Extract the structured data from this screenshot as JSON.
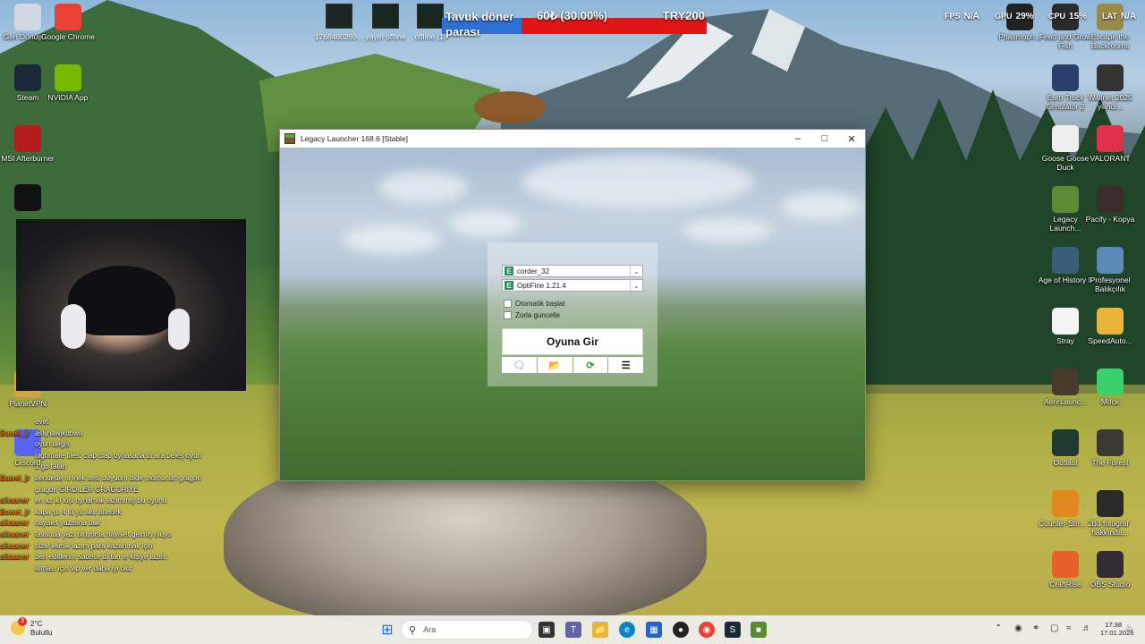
{
  "desktop_left": [
    {
      "id": "recycle",
      "label": "Geri Dönüşü...",
      "icon": "recycle-bin-icon",
      "color": "#cfd8e3"
    },
    {
      "id": "chrome",
      "label": "Google Chrome",
      "icon": "chrome-icon",
      "color": "#e94235"
    },
    {
      "id": "steam",
      "label": "Steam",
      "icon": "steam-icon",
      "color": "#1b2838"
    },
    {
      "id": "nvidia",
      "label": "NVIDIA App",
      "icon": "nvidia-icon",
      "color": "#76b900"
    },
    {
      "id": "afterburner",
      "label": "MSI Afterburner",
      "icon": "afterburner-icon",
      "color": "#b51c1c"
    },
    {
      "id": "rave",
      "label": "",
      "icon": "rave-icon",
      "color": "#111111"
    },
    {
      "id": "planetvpn",
      "label": "PlanetVPN",
      "icon": "vpn-icon",
      "color": "#d8a33b"
    },
    {
      "id": "discord",
      "label": "Discord",
      "icon": "discord-icon",
      "color": "#5865f2"
    }
  ],
  "desktop_right": [
    {
      "id": "phasmo",
      "label": "Phasmoph...",
      "icon": "phasmophobia-icon",
      "color": "#222222"
    },
    {
      "id": "feedgrow",
      "label": "Feed and Grow Fish",
      "icon": "feed-grow-icon",
      "color": "#2a2a2a"
    },
    {
      "id": "backrooms",
      "label": "Escape the Backrooms",
      "icon": "backrooms-icon",
      "color": "#9a8a4a"
    },
    {
      "id": "ets2",
      "label": "Euro Truck Simulator 2",
      "icon": "truck-icon",
      "color": "#2b3f6b"
    },
    {
      "id": "wallnet",
      "label": "Wallnet 2025 yilindi...",
      "icon": "wallnet-icon",
      "color": "#333333"
    },
    {
      "id": "goose",
      "label": "Goose Goose Duck",
      "icon": "goose-icon",
      "color": "#eeeeee"
    },
    {
      "id": "valorant",
      "label": "VALORANT",
      "icon": "valorant-icon",
      "color": "#e0304a"
    },
    {
      "id": "legacy",
      "label": "Legacy Launch...",
      "icon": "minecraft-icon",
      "color": "#5b8a35"
    },
    {
      "id": "pacify",
      "label": "Pacify - Kopya",
      "icon": "pacify-icon",
      "color": "#3a2c2a"
    },
    {
      "id": "aoe2",
      "label": "Age of History II",
      "icon": "aoh-icon",
      "color": "#3a5d7a"
    },
    {
      "id": "fishing",
      "label": "Profesyonel Balıkçılık",
      "icon": "fishing-icon",
      "color": "#5a8ab5"
    },
    {
      "id": "stray",
      "label": "Stray",
      "icon": "stray-icon",
      "color": "#f4f4f4"
    },
    {
      "id": "speedauto",
      "label": "SpeedAuto...",
      "icon": "folder-icon",
      "color": "#e8b43a"
    },
    {
      "id": "aerlaunch",
      "label": "AerirLaunc...",
      "icon": "aerir-icon",
      "color": "#4a3a2a"
    },
    {
      "id": "mock",
      "label": "Mock",
      "icon": "mock-icon",
      "color": "#3ad16a"
    },
    {
      "id": "outlast",
      "label": "Outlast",
      "icon": "outlast-icon",
      "color": "#1e3a30"
    },
    {
      "id": "forest",
      "label": "The Forest",
      "icon": "forest-icon",
      "color": "#3a3a33"
    },
    {
      "id": "cs2",
      "label": "Counter-Stri... 2",
      "icon": "cs2-icon",
      "color": "#e0871e"
    },
    {
      "id": "foto",
      "label": "Bu fotoğraf hakkında...",
      "icon": "camera-icon",
      "color": "#2a2a2a"
    },
    {
      "id": "craftrise",
      "label": "CraftRise",
      "icon": "craftrise-icon",
      "color": "#e8602a"
    },
    {
      "id": "obs",
      "label": "OBS Studio",
      "icon": "obs-icon",
      "color": "#302e31"
    }
  ],
  "top_tiles": [
    {
      "label": "1768480269...",
      "icon": "video-thumb-icon"
    },
    {
      "label": "yayın offline",
      "icon": "offline-thumb-icon"
    },
    {
      "label": "offline (1)",
      "icon": "offline-thumb-icon"
    }
  ],
  "goal": {
    "title": "Tavuk döner parası",
    "amount": "60₺ (30.00%)",
    "progress_percent": 30,
    "target": "TRY200",
    "fill_color": "#2f6fd6",
    "bar_color": "#e01515"
  },
  "perf": [
    {
      "label": "FPS",
      "value": "N/A"
    },
    {
      "label": "GPU",
      "value": "29%"
    },
    {
      "label": "CPU",
      "value": "15%"
    },
    {
      "label": "LAT",
      "value": "N/A"
    }
  ],
  "chat": [
    {
      "user": "",
      "text": "evet"
    },
    {
      "user": "Buwei_jr",
      "text": "aslijnawjkdbwa"
    },
    {
      "user": "",
      "text": "oyun değiş"
    },
    {
      "user": "",
      "text": "nighmare files: clap clap oynasana bi ara beleş oyun 1 gb falan"
    },
    {
      "user": "Buwei_jr",
      "text": "bendede ni inek sesi duyuom bide momunun gragori gragori GİRDİLER GRAGORİYE"
    },
    {
      "user": "alkaaner",
      "text": "en az iki kişi oynamak lazımmış bu oyunu"
    },
    {
      "user": "Buwei_jr",
      "text": "kapa şu 4 lü yü aku bitecek"
    },
    {
      "user": "alkaaner",
      "text": "hayalet yazısına bak"
    },
    {
      "user": "alkaaner",
      "text": "tavanda yazı oluyorsa hayalet gelmiş oluyo"
    },
    {
      "user": "alkaaner",
      "text": "bizw kemik lazım para kazanmak için"
    },
    {
      "user": "alkaaner",
      "text": "ben editlerim sadece bi tan ie kişiye lazım"
    },
    {
      "user": "",
      "text": "alması için vip ver daha iyi olur"
    }
  ],
  "launcher": {
    "title": "Legacy Launcher 168.6 [Stable]",
    "account": "corder_32",
    "version": "OptiFine 1.21.4",
    "auto_start": "Otomatik başlat",
    "force_update": "Zorla guncelle",
    "play": "Oyuna Gir"
  },
  "taskbar": {
    "weather_temp": "2°C",
    "weather_desc": "Bulutlu",
    "weather_badge": "3",
    "search_placeholder": "Ara",
    "time": "17:38",
    "date": "17.01.2026"
  }
}
